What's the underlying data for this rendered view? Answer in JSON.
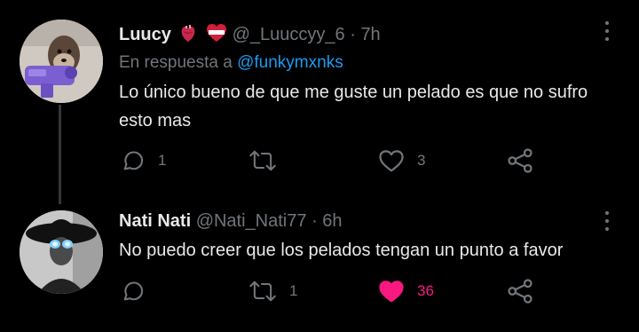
{
  "tweets": [
    {
      "name": "Luucy",
      "handle": "@_Luuccyy_6",
      "separator": "·",
      "time": "7h",
      "reply_prefix": "En respuesta a",
      "reply_to": "@funkymxnks",
      "text": "Lo único bueno de que me guste un pelado es que no sufro esto mas",
      "replies": "1",
      "retweets": "",
      "likes": "3"
    },
    {
      "name": "Nati Nati",
      "handle": "@Nati_Nati77",
      "separator": "·",
      "time": "6h",
      "text": "No puedo creer que los pelados tengan un punto a favor",
      "replies": "",
      "retweets": "1",
      "likes": "36",
      "liked": true
    }
  ],
  "colors": {
    "background": "#000000",
    "text": "#e7e9ea",
    "muted": "#71767b",
    "link": "#1d9bf0",
    "like": "#f91880",
    "thread_line": "#333639"
  },
  "icons": [
    "reply-icon",
    "retweet-icon",
    "like-icon",
    "share-icon",
    "more-icon",
    "anatomical-heart-emoji",
    "badge-emoji"
  ]
}
